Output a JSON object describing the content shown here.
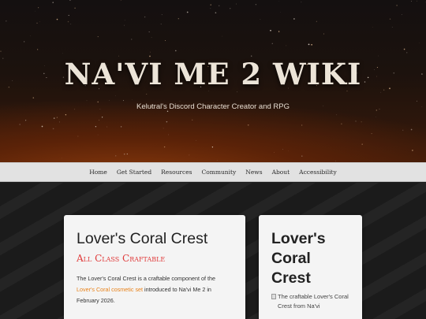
{
  "site": {
    "title": "NA'VI ME 2 WIKI",
    "subtitle": "Kelutral's Discord Character Creator and RPG"
  },
  "nav": {
    "items": [
      {
        "label": "Home"
      },
      {
        "label": "Get Started"
      },
      {
        "label": "Resources"
      },
      {
        "label": "Community"
      },
      {
        "label": "News"
      },
      {
        "label": "About"
      },
      {
        "label": "Accessibility"
      }
    ]
  },
  "article": {
    "title": "Lover's Coral Crest",
    "category": "All Class Craftable",
    "intro_before": "The Lover's Coral Crest is a craftable component of the ",
    "intro_link": "Lover's Coral cosmetic set",
    "intro_after": " introduced to Na'vi Me 2 in February 2026."
  },
  "infobox": {
    "title": "Lover's Coral Crest",
    "image_alt": "The craftable Lover's Coral Crest from Na'vi"
  },
  "colors": {
    "accent_link": "#e8821a",
    "category_red": "#e03a3a",
    "nav_bg": "#e2e2e2"
  }
}
